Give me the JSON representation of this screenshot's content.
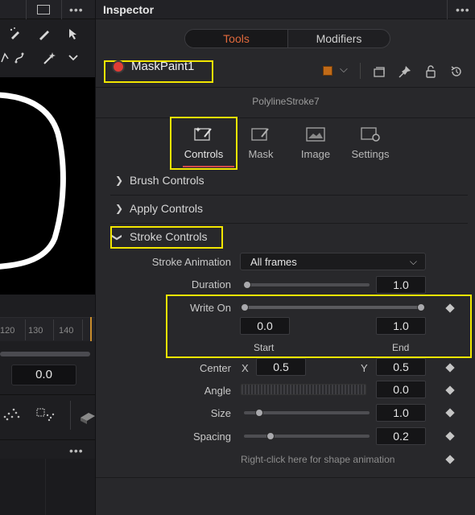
{
  "left_panel": {
    "ruler_labels": [
      "120",
      "130",
      "140"
    ],
    "value": "0.0"
  },
  "inspector": {
    "title": "Inspector",
    "segments": {
      "tools": "Tools",
      "modifiers": "Modifiers"
    },
    "node": {
      "name": "MaskPaint1",
      "color": "#c06a18"
    },
    "subtitle": "PolylineStroke7",
    "tabs": [
      {
        "label": "Controls",
        "active": true
      },
      {
        "label": "Mask"
      },
      {
        "label": "Image"
      },
      {
        "label": "Settings"
      }
    ],
    "sections": [
      {
        "label": "Brush Controls",
        "expanded": false
      },
      {
        "label": "Apply Controls",
        "expanded": false
      },
      {
        "label": "Stroke Controls",
        "expanded": true
      }
    ],
    "params": {
      "stroke_animation": {
        "label": "Stroke Animation",
        "value": "All frames"
      },
      "duration": {
        "label": "Duration",
        "value": "1.0",
        "fraction": 0.0
      },
      "write_on": {
        "label": "Write On",
        "start": "0.0",
        "end": "1.0",
        "start_caption": "Start",
        "end_caption": "End"
      },
      "center": {
        "label": "Center",
        "x_label": "X",
        "y_label": "Y",
        "x": "0.5",
        "y": "0.5"
      },
      "angle": {
        "label": "Angle",
        "value": "0.0"
      },
      "size": {
        "label": "Size",
        "value": "1.0",
        "fraction": 0.1
      },
      "spacing": {
        "label": "Spacing",
        "value": "0.2",
        "fraction": 0.2
      }
    },
    "hint": "Right-click here for shape animation"
  }
}
